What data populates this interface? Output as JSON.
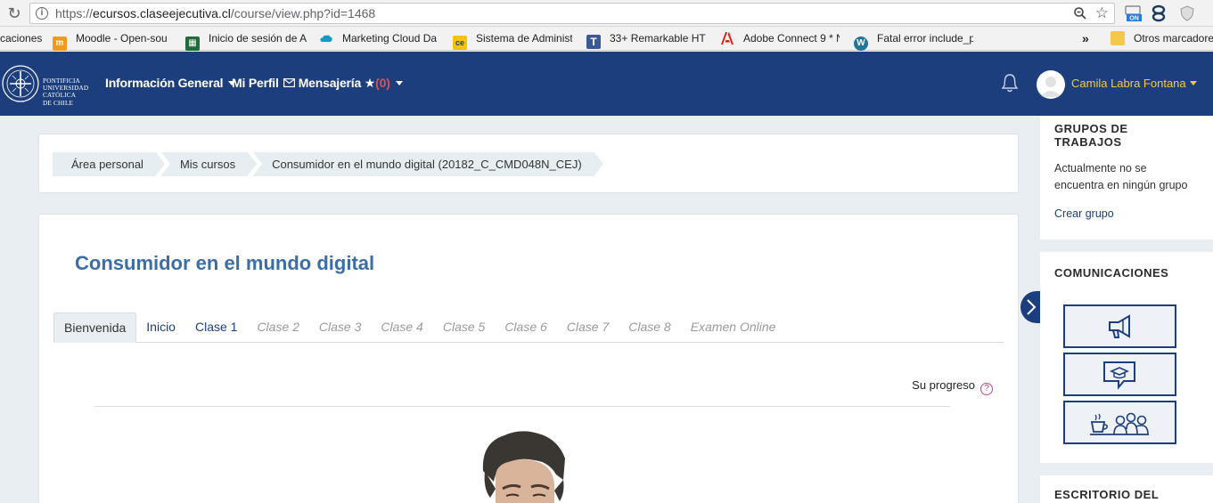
{
  "browser": {
    "url_prefix": "https://",
    "url_host": "ecursos.claseejecutiva.cl",
    "url_path": "/course/view.php?id=1468",
    "ext_badge": "ON",
    "bookmarks": [
      {
        "label": "caciones",
        "icon": "apps-icon"
      },
      {
        "label": "Moodle - Open-sou",
        "icon": "moodle-icon"
      },
      {
        "label": "Inicio de sesión de A",
        "icon": "sheet-icon"
      },
      {
        "label": "Marketing Cloud Da",
        "icon": "cloud-icon"
      },
      {
        "label": "Sistema de Administ",
        "icon": "ce-icon"
      },
      {
        "label": "33+ Remarkable HT",
        "icon": "t-icon"
      },
      {
        "label": "Adobe Connect 9 * N",
        "icon": "adobe-icon"
      },
      {
        "label": "Fatal error include_p",
        "icon": "wordpress-icon"
      }
    ],
    "more": "»",
    "other_bookmarks": "Otros marcadore"
  },
  "logo": {
    "line1": "PONTIFICIA",
    "line2": "UNIVERSIDAD",
    "line3": "CATÓLICA",
    "line4": "DE CHILE"
  },
  "nav": {
    "info_general": "Información General",
    "mi_perfil": "Mi Perfil",
    "mensajeria": "Mensajería",
    "star": "★",
    "count": "(0)",
    "username": "Camila Labra Fontana"
  },
  "breadcrumb": [
    "Área personal",
    "Mis cursos",
    "Consumidor en el mundo digital (20182_C_CMD048N_CEJ)"
  ],
  "course": {
    "title": "Consumidor en el mundo digital",
    "tabs": [
      {
        "label": "Bienvenida",
        "state": "active"
      },
      {
        "label": "Inicio",
        "state": "enabled"
      },
      {
        "label": "Clase 1",
        "state": "enabled"
      },
      {
        "label": "Clase 2",
        "state": "disabled"
      },
      {
        "label": "Clase 3",
        "state": "disabled"
      },
      {
        "label": "Clase 4",
        "state": "disabled"
      },
      {
        "label": "Clase 5",
        "state": "disabled"
      },
      {
        "label": "Clase 6",
        "state": "disabled"
      },
      {
        "label": "Clase 7",
        "state": "disabled"
      },
      {
        "label": "Clase 8",
        "state": "disabled"
      },
      {
        "label": "Examen Online",
        "state": "disabled"
      }
    ],
    "progress_label": "Su progreso",
    "help": "?"
  },
  "sidebar": {
    "groups_title": "GRUPOS DE TRABAJOS",
    "groups_text": "Actualmente no se encuentra en ningún grupo",
    "groups_link": "Crear grupo",
    "comms_title": "COMUNICACIONES",
    "comms_buttons": [
      "megaphone-icon",
      "graduation-chat-icon",
      "coffee-group-icon"
    ],
    "desk_title": "ESCRITORIO DEL"
  },
  "colors": {
    "navbar": "#1d3e7d",
    "title": "#3a6ea5",
    "username": "#f5c842",
    "notify": "#d9534f"
  }
}
